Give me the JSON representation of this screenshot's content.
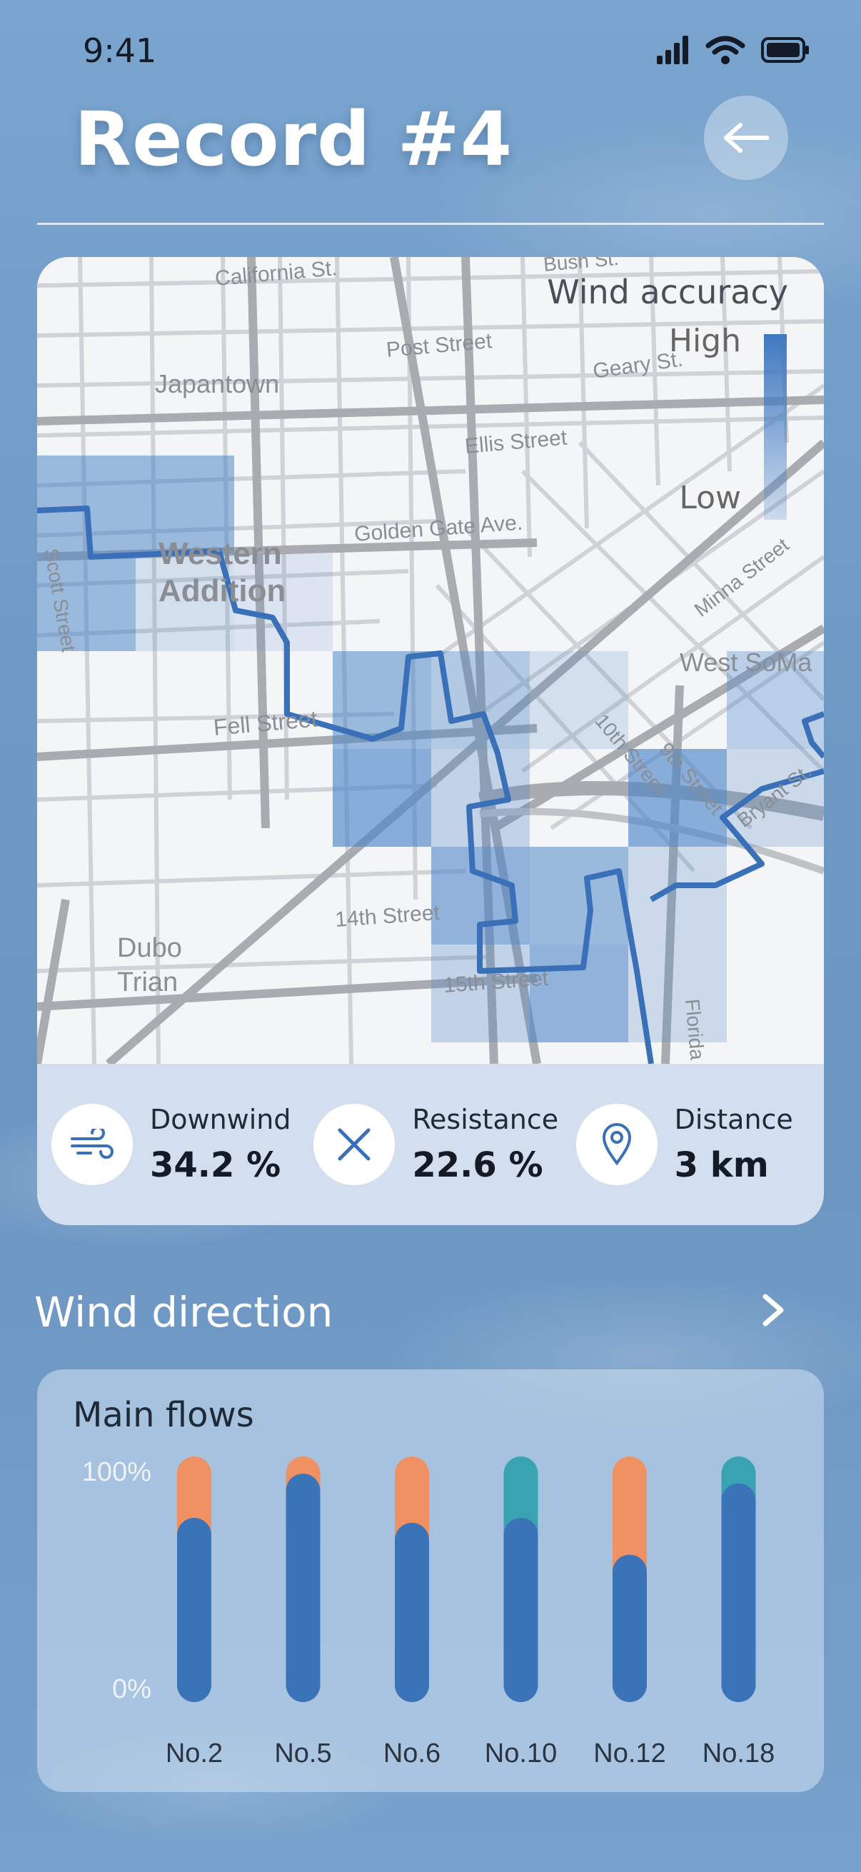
{
  "status_bar": {
    "time": "9:41"
  },
  "header": {
    "title": "Record #4"
  },
  "map": {
    "legend_title": "Wind accuracy",
    "legend_high": "High",
    "legend_low": "Low",
    "labels": {
      "california": "California St.",
      "bush": "Bush St.",
      "post": "Post Street",
      "geary": "Geary St.",
      "japantown": "Japantown",
      "ellis": "Ellis Street",
      "golden_gate": "Golden Gate Ave.",
      "western": "Western",
      "addition": "Addition",
      "scott": "Scott Street",
      "minna": "Minna Street",
      "west_soma": "West SoMa",
      "fell": "Fell Street",
      "tenth": "10th Street",
      "ninth": "9th Street",
      "bryant": "Bryant St.",
      "fourteenth": "14th Street",
      "fifteenth": "15th Street",
      "dubo": "Dubo",
      "trian": "Trian",
      "florida": "Florida"
    }
  },
  "stats": [
    {
      "label": "Downwind",
      "value": "34.2 %",
      "icon": "wind-icon"
    },
    {
      "label": "Resistance",
      "value": "22.6 %",
      "icon": "close-x-icon"
    },
    {
      "label": "Distance",
      "value": "3 km",
      "icon": "location-pin-icon"
    }
  ],
  "wind_direction": {
    "title": "Wind direction"
  },
  "flows": {
    "title": "Main flows",
    "colors": {
      "primary": "#3b73b8",
      "orange": "#ef9163",
      "teal": "#3aa3b1"
    },
    "chart_data": {
      "type": "bar",
      "stacked": true,
      "categories": [
        "No.2",
        "No.5",
        "No.6",
        "No.10",
        "No.12",
        "No.18"
      ],
      "series": [
        {
          "values": [
            75,
            93,
            73,
            75,
            60,
            89
          ]
        },
        {
          "values": [
            25,
            7,
            27,
            0,
            40,
            0
          ]
        },
        {
          "values": [
            0,
            0,
            0,
            25,
            0,
            11
          ]
        }
      ],
      "yticks": [
        "100%",
        "0%"
      ],
      "ylim": [
        0,
        100
      ]
    }
  }
}
